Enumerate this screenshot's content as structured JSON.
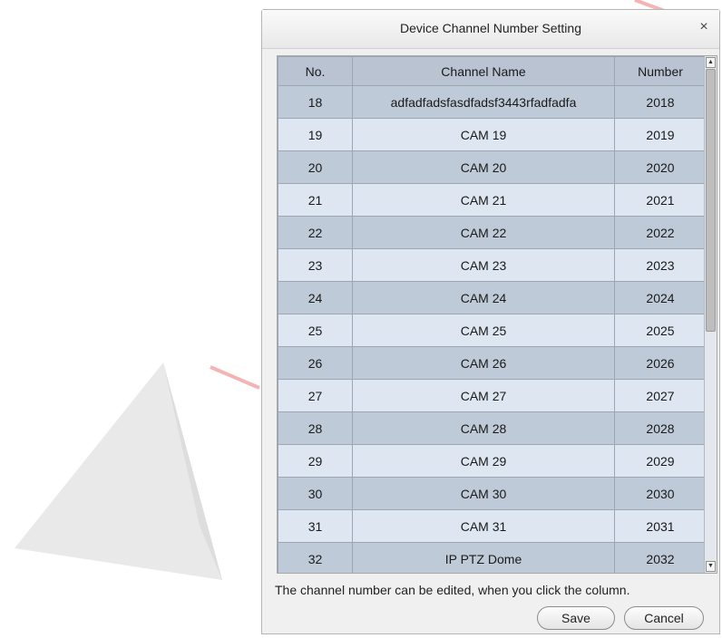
{
  "dialog": {
    "title": "Device Channel Number Setting",
    "close_glyph": "×",
    "hint": "The channel number can be edited, when you click the column.",
    "save_label": "Save",
    "cancel_label": "Cancel"
  },
  "table": {
    "headers": [
      "No.",
      "Channel Name",
      "Number"
    ],
    "rows": [
      [
        "18",
        "adfadfadsfasdfadsf3443rfadfadfa",
        "2018"
      ],
      [
        "19",
        "CAM 19",
        "2019"
      ],
      [
        "20",
        "CAM 20",
        "2020"
      ],
      [
        "21",
        "CAM 21",
        "2021"
      ],
      [
        "22",
        "CAM 22",
        "2022"
      ],
      [
        "23",
        "CAM 23",
        "2023"
      ],
      [
        "24",
        "CAM 24",
        "2024"
      ],
      [
        "25",
        "CAM 25",
        "2025"
      ],
      [
        "26",
        "CAM 26",
        "2026"
      ],
      [
        "27",
        "CAM 27",
        "2027"
      ],
      [
        "28",
        "CAM 28",
        "2028"
      ],
      [
        "29",
        "CAM 29",
        "2029"
      ],
      [
        "30",
        "CAM 30",
        "2030"
      ],
      [
        "31",
        "CAM 31",
        "2031"
      ],
      [
        "32",
        "IP PTZ Dome",
        "2032"
      ]
    ]
  },
  "colors": {
    "header_bg": "#b9c3d1",
    "row_dark": "#bfcad8",
    "row_light": "#dde6f1",
    "dialog_bg": "#f0f0f0"
  },
  "icons": {
    "close": "close-icon",
    "scroll_up": "scroll-up-arrow-icon",
    "scroll_down": "scroll-down-arrow-icon"
  }
}
